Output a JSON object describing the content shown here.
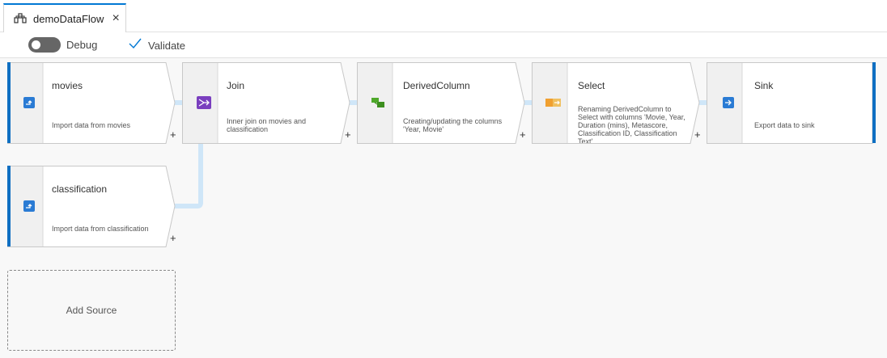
{
  "tab": {
    "title": "demoDataFlow",
    "icon": "dataflow-icon",
    "close": "×"
  },
  "toolbar": {
    "debug_label": "Debug",
    "debug_on": false,
    "validate_label": "Validate"
  },
  "nodes": [
    {
      "name": "movies",
      "description": "Import data from movies",
      "icon": "source-icon"
    },
    {
      "name": "Join",
      "description": "Inner join on movies and classification",
      "icon": "join-icon"
    },
    {
      "name": "DerivedColumn",
      "description": "Creating/updating the columns 'Year, Movie'",
      "icon": "derived-column-icon"
    },
    {
      "name": "Select",
      "description": "Renaming DerivedColumn to Select with columns 'Movie, Year, Duration (mins), Metascore, Classification ID, Classification Text'",
      "icon": "select-icon"
    },
    {
      "name": "Sink",
      "description": "Export data to sink",
      "icon": "sink-icon"
    },
    {
      "name": "classification",
      "description": "Import data from classification",
      "icon": "source-icon"
    }
  ],
  "plus": "+",
  "add_source": "Add Source",
  "colors": {
    "accent": "#0f6fc2",
    "connector": "#cfe6f8",
    "tab_accent": "#0078d4"
  }
}
